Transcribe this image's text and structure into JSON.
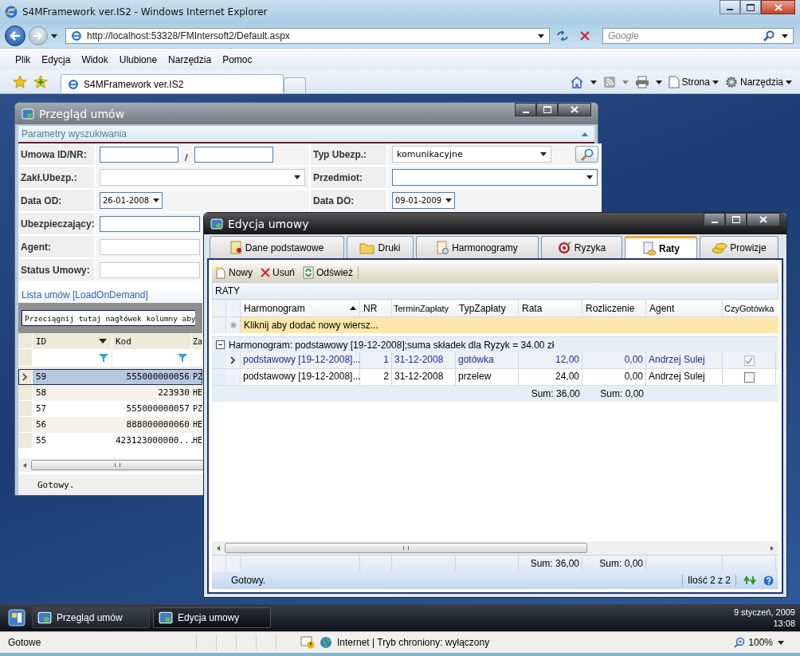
{
  "browser": {
    "title": "S4MFramework ver.IS2 - Windows Internet Explorer",
    "address": "http://localhost:53328/FMIntersoft2/Default.aspx",
    "search_placeholder": "Google",
    "menu": [
      "Plik",
      "Edycja",
      "Widok",
      "Ulubione",
      "Narzędzia",
      "Pomoc"
    ],
    "tab": "S4MFramework ver.IS2",
    "commands": [
      "Strona",
      "Narzędzia"
    ]
  },
  "list_window": {
    "title": "Przegląd umów",
    "panel_title": "Parametry wyszukiwania",
    "expanded": true,
    "left_fields": [
      {
        "label": "Umowa ID/NR:",
        "kind": "pair",
        "separator": "/"
      },
      {
        "label": "Zakł.Ubezp.:",
        "kind": "combo"
      },
      {
        "label": "Data OD:",
        "kind": "date",
        "value": "26-01-2008"
      },
      {
        "label": "Ubezpieczający:",
        "kind": "text"
      },
      {
        "label": "Agent:",
        "kind": "text"
      },
      {
        "label": "Status Umowy:",
        "kind": "text"
      }
    ],
    "right_fields": [
      {
        "label": "Typ Ubezp.:",
        "kind": "combo",
        "value": "komunikacyjne"
      },
      {
        "label": "Przedmiot:",
        "kind": "combo"
      },
      {
        "label": "Data DO:",
        "kind": "date",
        "value": "09-01-2009"
      }
    ],
    "grid_title": "Lista umów [LoadOnDemand]",
    "group_hint": "Przeciągnij tutaj nagłówek kolumny aby",
    "columns": [
      {
        "label": "ID",
        "menu": true,
        "filter": true
      },
      {
        "label": "Kod",
        "menu": false,
        "filter": true
      },
      {
        "label": "Za",
        "menu": false,
        "filter": false
      }
    ],
    "rows": [
      {
        "cells": [
          "59",
          "555000000056",
          "PZ"
        ],
        "selected": true
      },
      {
        "cells": [
          "58",
          "223930",
          "HE"
        ],
        "selected": false
      },
      {
        "cells": [
          "57",
          "555000000057",
          "PZ"
        ],
        "selected": false
      },
      {
        "cells": [
          "56",
          "888000000060",
          "HE"
        ],
        "selected": false
      },
      {
        "cells": [
          "55",
          "423123000000...",
          "HE"
        ],
        "selected": false
      }
    ],
    "status": "Gotowy."
  },
  "edit_window": {
    "title": "Edycja umowy",
    "tabs": [
      {
        "label": "Dane podstawowe",
        "selected": false
      },
      {
        "label": "Druki",
        "selected": false
      },
      {
        "label": "Harmonogramy",
        "selected": false
      },
      {
        "label": "Ryzyka",
        "selected": false
      },
      {
        "label": "Raty",
        "selected": true
      },
      {
        "label": "Prowizje",
        "selected": false
      }
    ],
    "toolbar": [
      "Nowy",
      "Usuń",
      "Odśwież"
    ],
    "caption": "RATY",
    "columns": [
      {
        "label": "Harmonogram",
        "sorted": true,
        "kind": "text"
      },
      {
        "label": "NR",
        "sorted": false,
        "kind": "number"
      },
      {
        "label": "TerminZapłaty",
        "sorted": false,
        "kind": "text"
      },
      {
        "label": "TypZapłaty",
        "sorted": false,
        "kind": "text"
      },
      {
        "label": "Rata",
        "sorted": false,
        "kind": "number",
        "group_sum": "Sum: 36,00",
        "footer_sum": "Sum: 36,00"
      },
      {
        "label": "Rozliczenie",
        "sorted": false,
        "kind": "number",
        "group_sum": "Sum: 0,00",
        "footer_sum": "Sum: 0,00"
      },
      {
        "label": "Agent",
        "sorted": false,
        "kind": "text"
      },
      {
        "label": "CzyGotówka",
        "sorted": false,
        "kind": "check"
      }
    ],
    "new_row": "Kliknij aby dodać nowy wiersz...",
    "group": {
      "text": "Harmonogram: podstawowy [19-12-2008];suma składek dla Ryzyk = 34.00 zł",
      "expanded": true,
      "rows": [
        {
          "cells": [
            "podstawowy [19-12-2008]...",
            "1",
            "31-12-2008",
            "gotówka",
            "12,00",
            "0,00",
            "Andrzej Sulej"
          ],
          "checked": true,
          "selected": true
        },
        {
          "cells": [
            "podstawowy [19-12-2008]...",
            "2",
            "31-12-2008",
            "przelew",
            "24,00",
            "0,00",
            "Andrzej Sulej"
          ],
          "checked": false,
          "selected": false
        }
      ]
    },
    "status": "Gotowy.",
    "count": "Ilość 2 z 2"
  },
  "taskbar": {
    "items": [
      {
        "label": "Przegląd umów",
        "selected": false
      },
      {
        "label": "Edycja umowy",
        "selected": true
      }
    ],
    "date": "9 styczeń, 2009",
    "time": "13:08"
  },
  "status_bar": {
    "text": "Gotowe",
    "zone": "Internet | Tryb chroniony: wyłączony",
    "zoom": "100%"
  }
}
